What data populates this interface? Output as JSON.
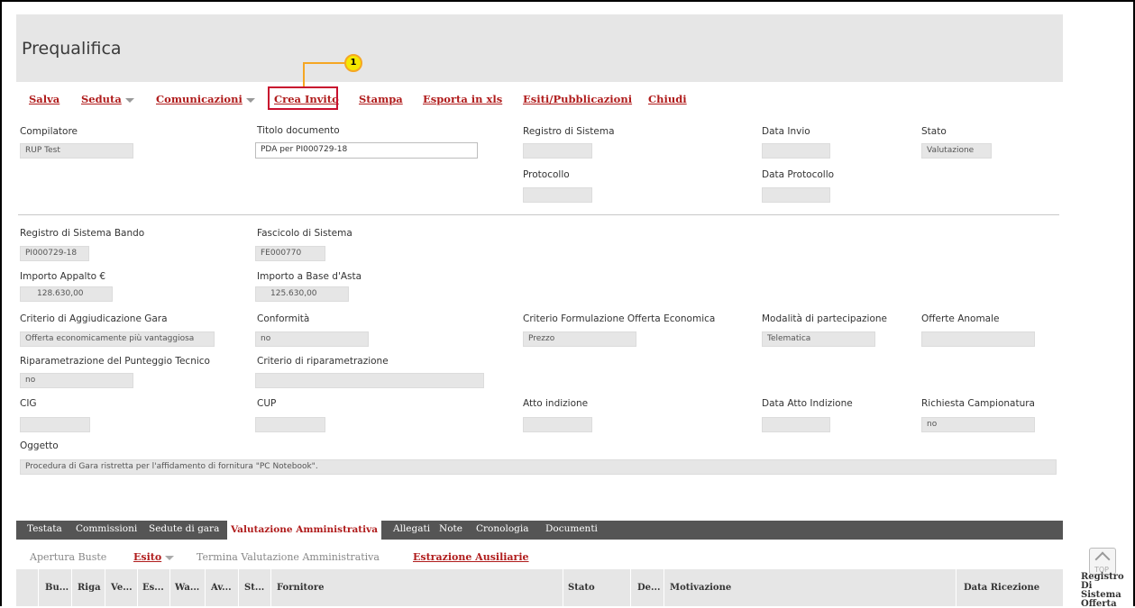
{
  "page_title": "Prequalifica",
  "toolbar": {
    "salva": "Salva",
    "seduta": "Seduta",
    "comunicazioni": "Comunicazioni",
    "crea_invito": "Crea Invito",
    "stampa": "Stampa",
    "esporta": "Esporta in xls",
    "esiti": "Esiti/Pubblicazioni",
    "chiudi": "Chiudi"
  },
  "callout": {
    "number": "1"
  },
  "fields": {
    "compilatore": {
      "label": "Compilatore",
      "value": "RUP Test"
    },
    "titolo_documento": {
      "label": "Titolo documento",
      "value": "PDA per PI000729-18"
    },
    "registro_sistema": {
      "label": "Registro di Sistema",
      "value": ""
    },
    "data_invio": {
      "label": "Data Invio",
      "value": ""
    },
    "stato": {
      "label": "Stato",
      "value": "Valutazione"
    },
    "protocollo": {
      "label": "Protocollo",
      "value": ""
    },
    "data_protocollo": {
      "label": "Data Protocollo",
      "value": ""
    },
    "registro_bando": {
      "label": "Registro di Sistema Bando",
      "value": "PI000729-18"
    },
    "fascicolo": {
      "label": "Fascicolo di Sistema",
      "value": "FE000770"
    },
    "importo_appalto": {
      "label": "Importo Appalto €",
      "value": "128.630,00"
    },
    "importo_base": {
      "label": "Importo a Base d'Asta",
      "value": "125.630,00"
    },
    "criterio_aggiudicazione": {
      "label": "Criterio di Aggiudicazione Gara",
      "value": "Offerta economicamente più vantaggiosa"
    },
    "conformita": {
      "label": "Conformità",
      "value": "no"
    },
    "criterio_formulazione": {
      "label": "Criterio Formulazione Offerta Economica",
      "value": "Prezzo"
    },
    "modalita": {
      "label": "Modalità di partecipazione",
      "value": "Telematica"
    },
    "offerte_anomale": {
      "label": "Offerte Anomale",
      "value": ""
    },
    "riparametrazione": {
      "label": "Riparametrazione del Punteggio Tecnico",
      "value": "no"
    },
    "criterio_riparametrazione": {
      "label": "Criterio di riparametrazione",
      "value": ""
    },
    "cig": {
      "label": "CIG",
      "value": ""
    },
    "cup": {
      "label": "CUP",
      "value": ""
    },
    "atto_indizione": {
      "label": "Atto indizione",
      "value": ""
    },
    "data_atto": {
      "label": "Data Atto Indizione",
      "value": ""
    },
    "campionatura": {
      "label": "Richiesta Campionatura",
      "value": "no"
    },
    "oggetto": {
      "label": "Oggetto",
      "value": "Procedura di Gara ristretta per l'affidamento di fornitura \"PC Notebook\"."
    }
  },
  "tabs": [
    "Testata",
    "Commissioni",
    "Sedute di gara",
    "Valutazione Amministrativa",
    "Allegati",
    "Note",
    "Cronologia",
    "Documenti"
  ],
  "subtoolbar": {
    "apertura": "Apertura Buste",
    "esito": "Esito",
    "termina": "Termina Valutazione Amministrativa",
    "estrazione": "Estrazione Ausiliarie"
  },
  "grid_columns": [
    "Bu...",
    "Riga",
    "Ve...",
    "Es...",
    "Wa...",
    "Av...",
    "St...",
    "Fornitore",
    "Stato",
    "De...",
    "Motivazione",
    "Data Ricezione"
  ],
  "grid_right_title": "Registro Di Sistema Offerta",
  "top_label": "TOP"
}
